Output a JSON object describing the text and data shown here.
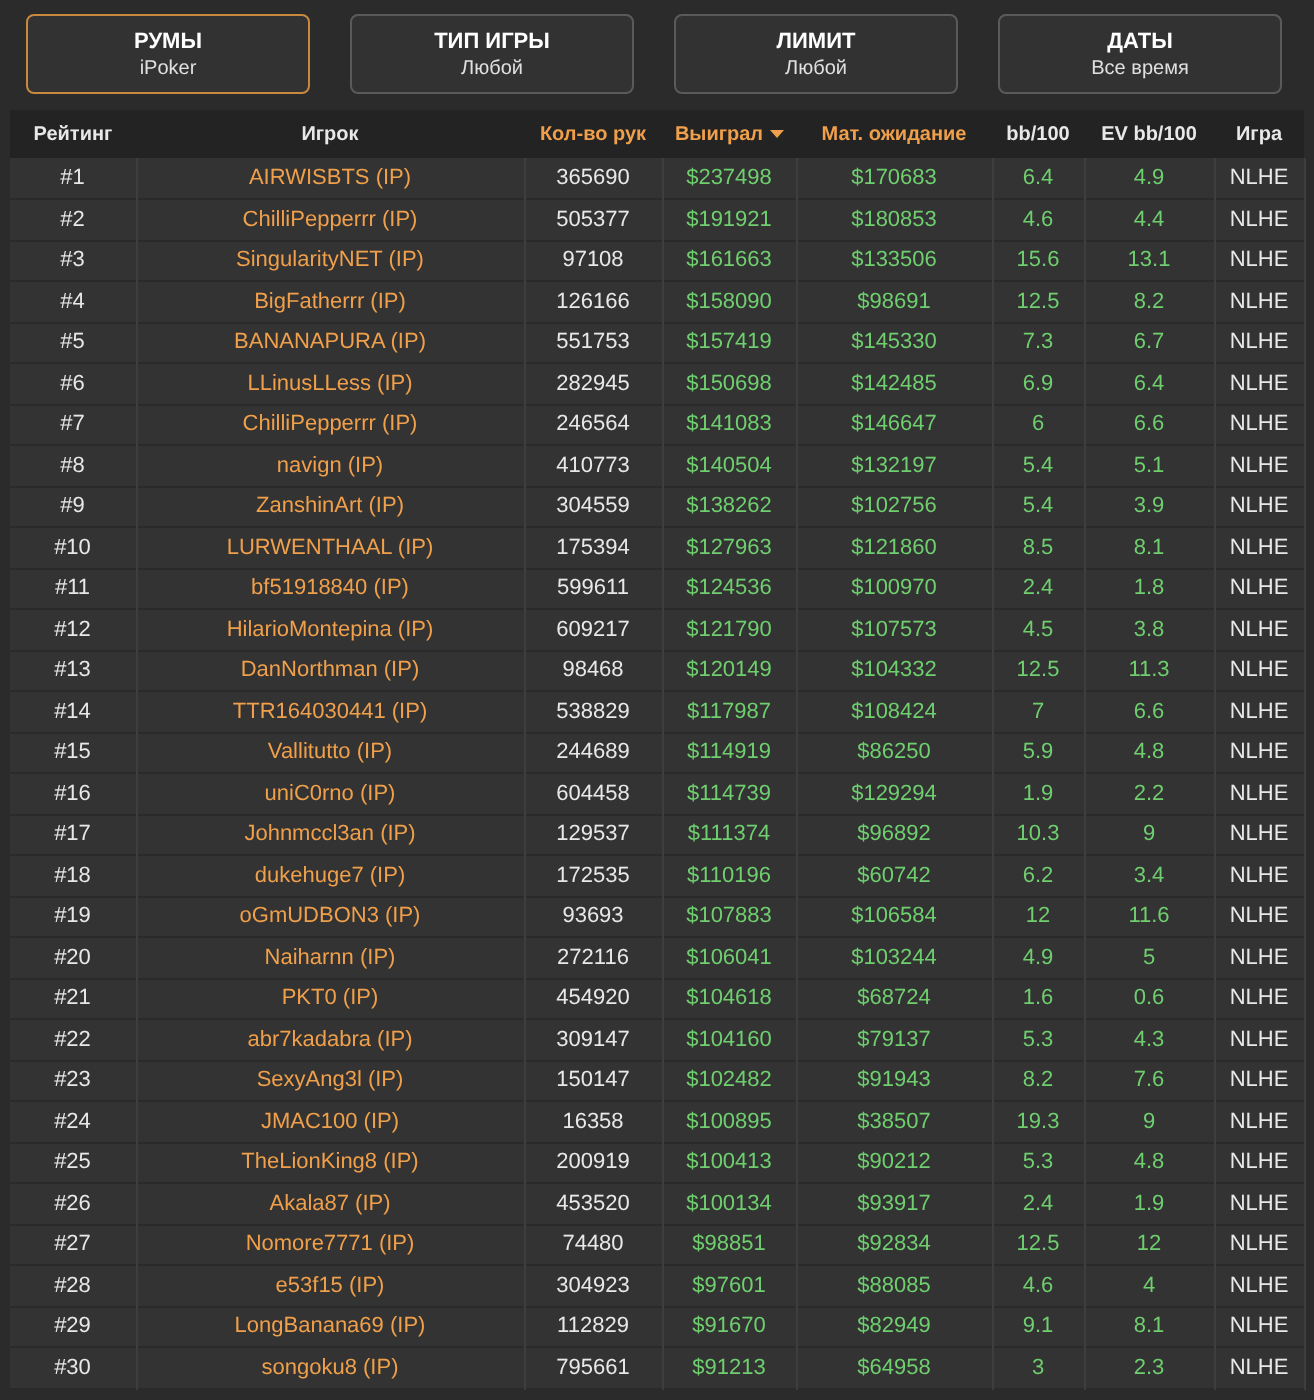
{
  "filters": [
    {
      "title": "РУМЫ",
      "value": "iPoker",
      "selected": true
    },
    {
      "title": "ТИП ИГРЫ",
      "value": "Любой",
      "selected": false
    },
    {
      "title": "ЛИМИТ",
      "value": "Любой",
      "selected": false
    },
    {
      "title": "ДАТЫ",
      "value": "Все время",
      "selected": false
    }
  ],
  "table": {
    "columns": [
      {
        "label": "Рейтинг",
        "sortable": false,
        "sorted": false
      },
      {
        "label": "Игрок",
        "sortable": false,
        "sorted": false
      },
      {
        "label": "Кол-во рук",
        "sortable": true,
        "sorted": false
      },
      {
        "label": "Выиграл",
        "sortable": true,
        "sorted": true
      },
      {
        "label": "Мат. ожидание",
        "sortable": true,
        "sorted": false
      },
      {
        "label": "bb/100",
        "sortable": false,
        "sorted": false
      },
      {
        "label": "EV bb/100",
        "sortable": false,
        "sorted": false
      },
      {
        "label": "Игра",
        "sortable": false,
        "sorted": false
      }
    ],
    "rows": [
      [
        "#1",
        "AIRWISBTS (IP)",
        "365690",
        "$237498",
        "$170683",
        "6.4",
        "4.9",
        "NLHE"
      ],
      [
        "#2",
        "ChilliPepperrr (IP)",
        "505377",
        "$191921",
        "$180853",
        "4.6",
        "4.4",
        "NLHE"
      ],
      [
        "#3",
        "SingularityNET (IP)",
        "97108",
        "$161663",
        "$133506",
        "15.6",
        "13.1",
        "NLHE"
      ],
      [
        "#4",
        "BigFatherrr (IP)",
        "126166",
        "$158090",
        "$98691",
        "12.5",
        "8.2",
        "NLHE"
      ],
      [
        "#5",
        "BANANAPURA (IP)",
        "551753",
        "$157419",
        "$145330",
        "7.3",
        "6.7",
        "NLHE"
      ],
      [
        "#6",
        "LLinusLLess (IP)",
        "282945",
        "$150698",
        "$142485",
        "6.9",
        "6.4",
        "NLHE"
      ],
      [
        "#7",
        "ChilliPepperrr (IP)",
        "246564",
        "$141083",
        "$146647",
        "6",
        "6.6",
        "NLHE"
      ],
      [
        "#8",
        "navign (IP)",
        "410773",
        "$140504",
        "$132197",
        "5.4",
        "5.1",
        "NLHE"
      ],
      [
        "#9",
        "ZanshinArt (IP)",
        "304559",
        "$138262",
        "$102756",
        "5.4",
        "3.9",
        "NLHE"
      ],
      [
        "#10",
        "LURWENTHAAL (IP)",
        "175394",
        "$127963",
        "$121860",
        "8.5",
        "8.1",
        "NLHE"
      ],
      [
        "#11",
        "bf51918840 (IP)",
        "599611",
        "$124536",
        "$100970",
        "2.4",
        "1.8",
        "NLHE"
      ],
      [
        "#12",
        "HilarioMontepina (IP)",
        "609217",
        "$121790",
        "$107573",
        "4.5",
        "3.8",
        "NLHE"
      ],
      [
        "#13",
        "DanNorthman (IP)",
        "98468",
        "$120149",
        "$104332",
        "12.5",
        "11.3",
        "NLHE"
      ],
      [
        "#14",
        "TTR164030441 (IP)",
        "538829",
        "$117987",
        "$108424",
        "7",
        "6.6",
        "NLHE"
      ],
      [
        "#15",
        "Vallitutto (IP)",
        "244689",
        "$114919",
        "$86250",
        "5.9",
        "4.8",
        "NLHE"
      ],
      [
        "#16",
        "uniC0rno (IP)",
        "604458",
        "$114739",
        "$129294",
        "1.9",
        "2.2",
        "NLHE"
      ],
      [
        "#17",
        "Johnmccl3an (IP)",
        "129537",
        "$111374",
        "$96892",
        "10.3",
        "9",
        "NLHE"
      ],
      [
        "#18",
        "dukehuge7 (IP)",
        "172535",
        "$110196",
        "$60742",
        "6.2",
        "3.4",
        "NLHE"
      ],
      [
        "#19",
        "oGmUDBON3 (IP)",
        "93693",
        "$107883",
        "$106584",
        "12",
        "11.6",
        "NLHE"
      ],
      [
        "#20",
        "Naiharnn (IP)",
        "272116",
        "$106041",
        "$103244",
        "4.9",
        "5",
        "NLHE"
      ],
      [
        "#21",
        "PKT0 (IP)",
        "454920",
        "$104618",
        "$68724",
        "1.6",
        "0.6",
        "NLHE"
      ],
      [
        "#22",
        "abr7kadabra (IP)",
        "309147",
        "$104160",
        "$79137",
        "5.3",
        "4.3",
        "NLHE"
      ],
      [
        "#23",
        "SexyAng3l (IP)",
        "150147",
        "$102482",
        "$91943",
        "8.2",
        "7.6",
        "NLHE"
      ],
      [
        "#24",
        "JMAC100 (IP)",
        "16358",
        "$100895",
        "$38507",
        "19.3",
        "9",
        "NLHE"
      ],
      [
        "#25",
        "TheLionKing8 (IP)",
        "200919",
        "$100413",
        "$90212",
        "5.3",
        "4.8",
        "NLHE"
      ],
      [
        "#26",
        "Akala87 (IP)",
        "453520",
        "$100134",
        "$93917",
        "2.4",
        "1.9",
        "NLHE"
      ],
      [
        "#27",
        "Nomore7771 (IP)",
        "74480",
        "$98851",
        "$92834",
        "12.5",
        "12",
        "NLHE"
      ],
      [
        "#28",
        "e53f15 (IP)",
        "304923",
        "$97601",
        "$88085",
        "4.6",
        "4",
        "NLHE"
      ],
      [
        "#29",
        "LongBanana69 (IP)",
        "112829",
        "$91670",
        "$82949",
        "9.1",
        "8.1",
        "NLHE"
      ],
      [
        "#30",
        "songoku8 (IP)",
        "795661",
        "$91213",
        "$64958",
        "3",
        "2.3",
        "NLHE"
      ]
    ]
  }
}
